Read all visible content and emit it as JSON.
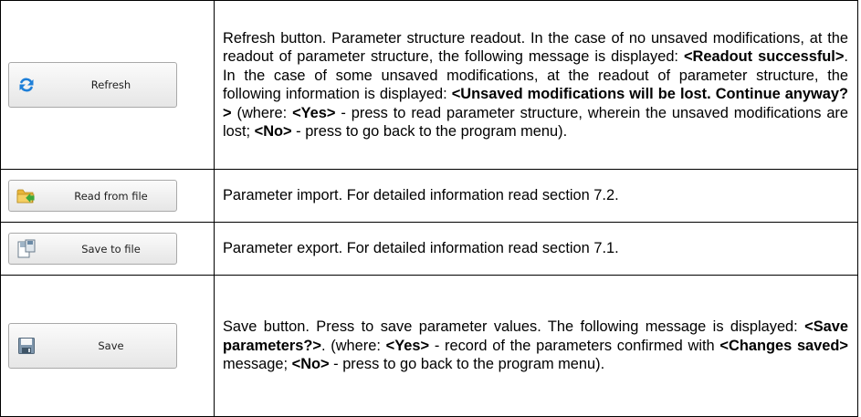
{
  "rows": [
    {
      "button": {
        "label": "Refresh",
        "icon": "refresh-icon"
      },
      "description": [
        {
          "t": "Refresh button. Parameter structure readout. In the case of no unsaved modifications, at the readout of parameter structure, the following message is displayed: "
        },
        {
          "t": "<Readout successful>",
          "b": true
        },
        {
          "t": ". In the case of some unsaved modifications, at the readout of parameter structure, the following information is displayed: "
        },
        {
          "t": "<Unsaved modifications will be lost. Continue anyway?>",
          "b": true
        },
        {
          "t": " (where: "
        },
        {
          "t": "<Yes>",
          "b": true
        },
        {
          "t": " - press to read parameter structure, wherein the unsaved modifications are lost; "
        },
        {
          "t": "<No>",
          "b": true
        },
        {
          "t": " - press to go back to the program menu)."
        }
      ]
    },
    {
      "button": {
        "label": "Read from file",
        "icon": "folder-import-icon"
      },
      "description": [
        {
          "t": "Parameter import. For detailed information read section 7.2."
        }
      ]
    },
    {
      "button": {
        "label": "Save to file",
        "icon": "save-to-file-icon"
      },
      "description": [
        {
          "t": "Parameter export. For detailed information read section 7.1."
        }
      ]
    },
    {
      "button": {
        "label": "Save",
        "icon": "floppy-disk-icon"
      },
      "description": [
        {
          "t": "Save button. Press to save parameter values. The following message is displayed: "
        },
        {
          "t": "<Save parameters?>",
          "b": true
        },
        {
          "t": ". (where: "
        },
        {
          "t": "<Yes>",
          "b": true
        },
        {
          "t": " - record of the parameters confirmed with "
        },
        {
          "t": "<Changes saved>",
          "b": true
        },
        {
          "t": " message; "
        },
        {
          "t": "<No>",
          "b": true
        },
        {
          "t": " - press to go back to the program menu)."
        }
      ]
    }
  ]
}
